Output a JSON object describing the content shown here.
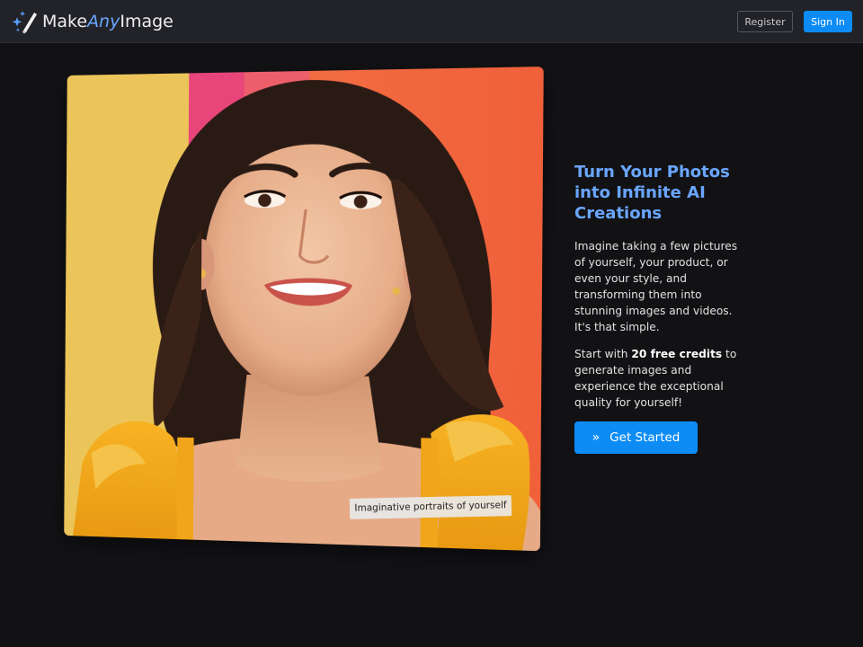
{
  "navbar": {
    "brand": {
      "part1": "Make",
      "part2": "Any",
      "part3": "Image",
      "icon": "magic-wand-sparkles-icon"
    },
    "register_label": "Register",
    "signin_label": "Sign In"
  },
  "hero": {
    "image_subject": "smiling woman portrait in yellow dress",
    "caption": "Imaginative portraits of yourself",
    "headline": "Turn Your Photos into Infinite AI Creations",
    "paragraph1": "Imagine taking a few pictures of yourself, your product, or even your style, and transforming them into stunning images and videos. It's that simple.",
    "paragraph2": {
      "before": "Start with ",
      "highlight": "20 free credits",
      "after": " to generate images and experience the exceptional quality for yourself!"
    },
    "cta_icon": "double-chevron-right-icon",
    "cta_label": "Get Started"
  },
  "colors": {
    "background": "#121215",
    "navbar": "#222328",
    "accent": "#6aa6ff",
    "primary_button": "#0d8cf5"
  }
}
